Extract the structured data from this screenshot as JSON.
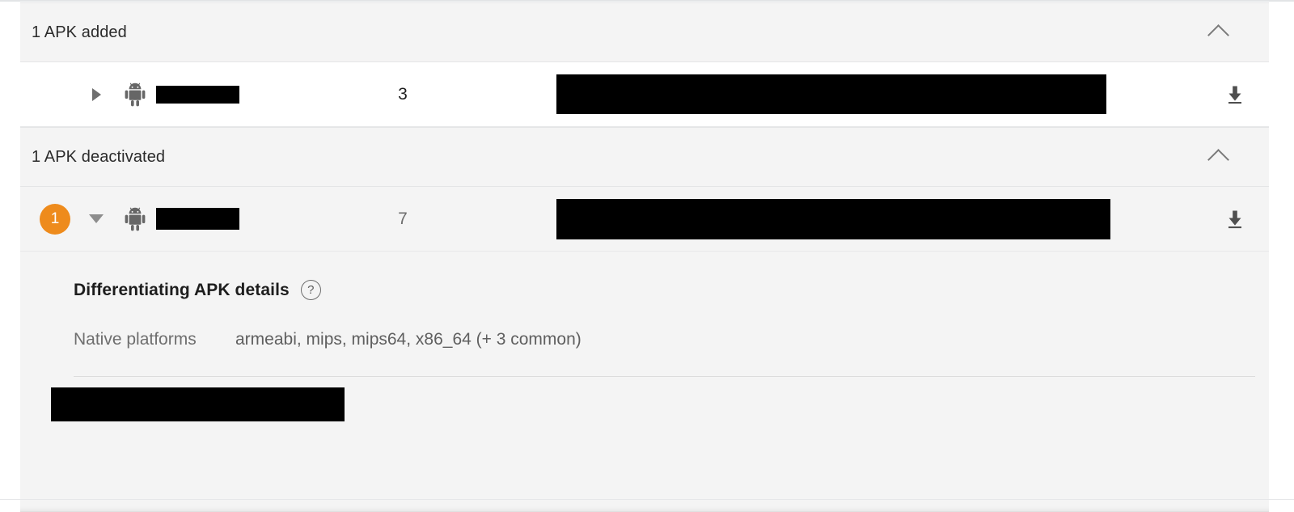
{
  "panel": {
    "sections": [
      {
        "id": "apk-added",
        "header_label": "1 APK added",
        "collapse_icon": "chevron-up-icon",
        "row": {
          "badge": "",
          "has_badge": false,
          "caret_icon": "caret-right-icon",
          "expanded": false,
          "app_icon": "android-robot-icon",
          "name_redacted": true,
          "name_text": "",
          "version_code": "3",
          "detail_redacted": true,
          "download_icon": "download-icon"
        }
      },
      {
        "id": "apk-deactivated",
        "header_label": "1 APK deactivated",
        "collapse_icon": "chevron-up-icon",
        "row": {
          "badge": "1",
          "has_badge": true,
          "caret_icon": "caret-down-icon",
          "expanded": true,
          "app_icon": "android-robot-icon",
          "name_redacted": true,
          "name_text": "",
          "version_code": "7",
          "detail_redacted": true,
          "download_icon": "download-icon"
        }
      }
    ]
  },
  "details": {
    "title": "Differentiating APK details",
    "help_icon": "help-circle-icon",
    "help_glyph": "?",
    "attributes": [
      {
        "label": "Native platforms",
        "value": "armeabi, mips, mips64, x86_64 (+ 3 common)"
      }
    ],
    "footer_redacted": true,
    "footer_text": ""
  },
  "colors": {
    "badge_orange": "#ee8b1c",
    "header_gray": "#f4f4f4",
    "row_white": "#ffffff",
    "redaction_black": "#000000",
    "border_gray": "#e4e5e6",
    "text_primary": "#1f1f1f",
    "text_muted": "#6e6e6e"
  }
}
